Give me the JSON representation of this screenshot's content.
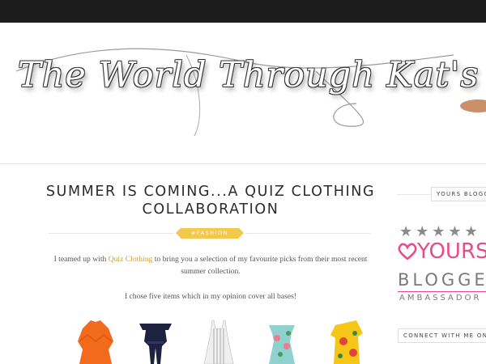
{
  "header": {
    "blog_title": "The World Through Kat's Eyes"
  },
  "post": {
    "title": "SUMMER IS COMING...A QUIZ CLOTHING COLLABORATION",
    "label": "#FASHION",
    "paragraph1_before": "I teamed up with ",
    "paragraph1_link": "Quiz Clothing",
    "paragraph1_after": " to bring you a selection of my favourite picks from their most recent summer collection.",
    "paragraph2": "I chose five items which in my opinion cover all bases!",
    "items": [
      {
        "name": "orange frill top",
        "color": "#f26a1b"
      },
      {
        "name": "navy bardot jumpsuit",
        "color": "#1d2240"
      },
      {
        "name": "striped midi dress",
        "color": "#d8d8d8"
      },
      {
        "name": "floral cold shoulder dress",
        "color": "#5fb3b3"
      },
      {
        "name": "yellow floral top",
        "color": "#f5c518"
      }
    ]
  },
  "sidebar": {
    "widget1_title": "YOURS BLOGGER",
    "badge": {
      "stars": "★★★★★",
      "yours": "YOURS",
      "blogger": "BLOGGER",
      "ambassador": "AMBASSADOR"
    },
    "widget2_title": "CONNECT WITH ME ONLINE"
  },
  "colors": {
    "topbar": "#1c1c1c",
    "label_gold": "#f2c94c",
    "link_gold": "#c6a33c",
    "yours_pink": "#e84a8a"
  }
}
